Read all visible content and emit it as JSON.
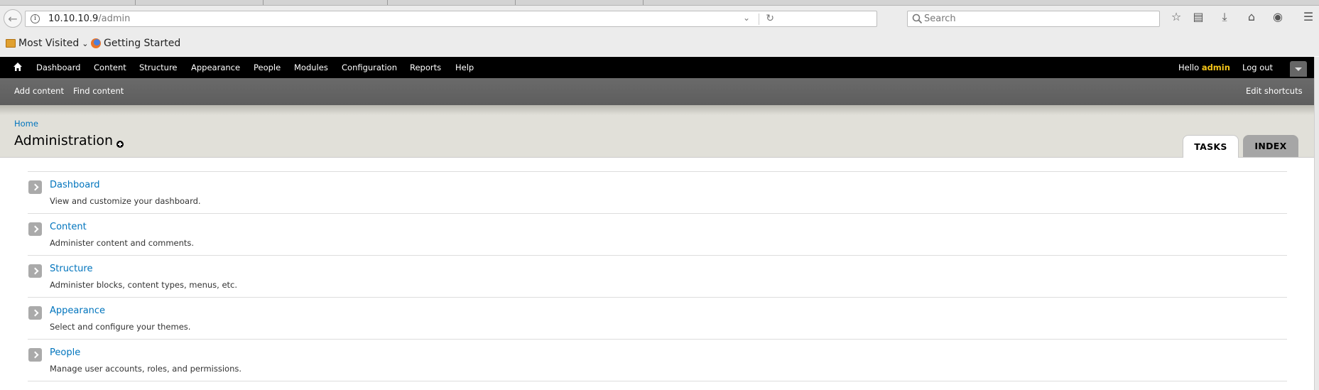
{
  "browser": {
    "url_host": "10.10.10.9",
    "url_path": "/admin",
    "search_placeholder": "Search",
    "bookmarks": {
      "most_visited": "Most Visited",
      "getting_started": "Getting Started"
    }
  },
  "toolbar": {
    "items": [
      "Dashboard",
      "Content",
      "Structure",
      "Appearance",
      "People",
      "Modules",
      "Configuration",
      "Reports",
      "Help"
    ],
    "hello_prefix": "Hello",
    "username": "admin",
    "logout": "Log out"
  },
  "shortcuts": {
    "add_content": "Add content",
    "find_content": "Find content",
    "edit_shortcuts": "Edit shortcuts"
  },
  "page": {
    "breadcrumb": "Home",
    "title": "Administration",
    "tabs": {
      "tasks": "TASKS",
      "index": "INDEX"
    }
  },
  "admin_items": [
    {
      "title": "Dashboard",
      "description": "View and customize your dashboard."
    },
    {
      "title": "Content",
      "description": "Administer content and comments."
    },
    {
      "title": "Structure",
      "description": "Administer blocks, content types, menus, etc."
    },
    {
      "title": "Appearance",
      "description": "Select and configure your themes."
    },
    {
      "title": "People",
      "description": "Manage user accounts, roles, and permissions."
    }
  ],
  "colors": {
    "link": "#0074bd",
    "toolbar_bg": "#000000",
    "shortcut_bg": "#666666",
    "header_bg": "#e1e0d9",
    "username": "#f5c518"
  }
}
